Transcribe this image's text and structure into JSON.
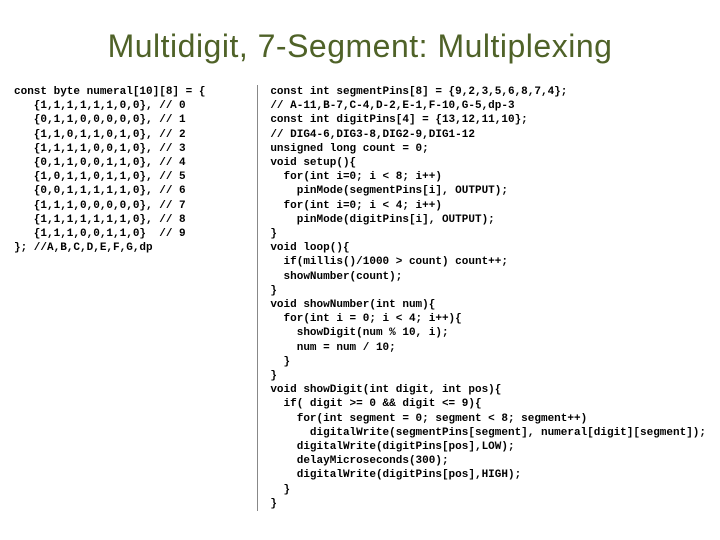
{
  "title": "Multidigit, 7-Segment: Multiplexing",
  "left_code": "const byte numeral[10][8] = {\n   {1,1,1,1,1,1,0,0}, // 0\n   {0,1,1,0,0,0,0,0}, // 1\n   {1,1,0,1,1,0,1,0}, // 2\n   {1,1,1,1,0,0,1,0}, // 3\n   {0,1,1,0,0,1,1,0}, // 4\n   {1,0,1,1,0,1,1,0}, // 5\n   {0,0,1,1,1,1,1,0}, // 6\n   {1,1,1,0,0,0,0,0}, // 7\n   {1,1,1,1,1,1,1,0}, // 8\n   {1,1,1,0,0,1,1,0}  // 9\n}; //A,B,C,D,E,F,G,dp",
  "right_code": "const int segmentPins[8] = {9,2,3,5,6,8,7,4};\n// A-11,B-7,C-4,D-2,E-1,F-10,G-5,dp-3\nconst int digitPins[4] = {13,12,11,10};\n// DIG4-6,DIG3-8,DIG2-9,DIG1-12\nunsigned long count = 0;\nvoid setup(){\n  for(int i=0; i < 8; i++)\n    pinMode(segmentPins[i], OUTPUT);\n  for(int i=0; i < 4; i++)\n    pinMode(digitPins[i], OUTPUT);\n}\nvoid loop(){\n  if(millis()/1000 > count) count++;\n  showNumber(count);\n}\nvoid showNumber(int num){\n  for(int i = 0; i < 4; i++){\n    showDigit(num % 10, i);\n    num = num / 10;\n  }\n}\nvoid showDigit(int digit, int pos){\n  if( digit >= 0 && digit <= 9){\n    for(int segment = 0; segment < 8; segment++)\n      digitalWrite(segmentPins[segment], numeral[digit][segment]);\n    digitalWrite(digitPins[pos],LOW);\n    delayMicroseconds(300);\n    digitalWrite(digitPins[pos],HIGH);\n  }\n}"
}
